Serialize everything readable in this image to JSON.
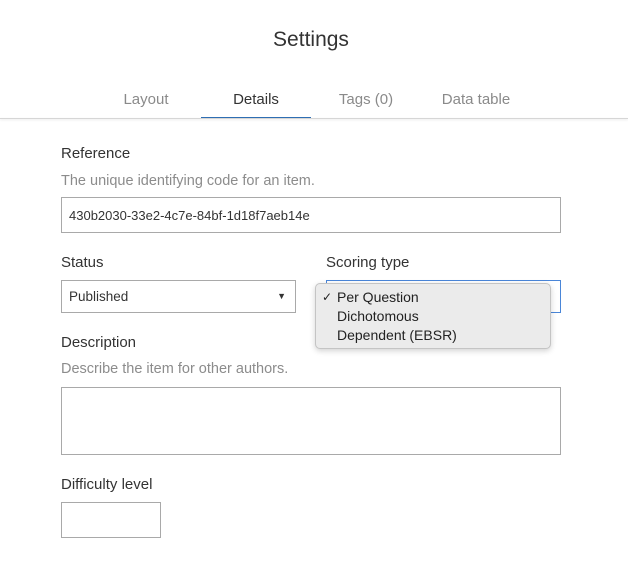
{
  "header": {
    "title": "Settings"
  },
  "tabs": [
    {
      "label": "Layout",
      "active": false
    },
    {
      "label": "Details",
      "active": true
    },
    {
      "label": "Tags (0)",
      "active": false
    },
    {
      "label": "Data table",
      "active": false
    }
  ],
  "reference": {
    "label": "Reference",
    "hint": "The unique identifying code for an item.",
    "value": "430b2030-33e2-4c7e-84bf-1d18f7aeb14e"
  },
  "status": {
    "label": "Status",
    "selected": "Published"
  },
  "scoring_type": {
    "label": "Scoring type",
    "options": [
      {
        "label": "Per Question",
        "checked": true
      },
      {
        "label": "Dichotomous",
        "checked": false
      },
      {
        "label": "Dependent (EBSR)",
        "checked": false
      }
    ],
    "check_glyph": "✓"
  },
  "description": {
    "label": "Description",
    "hint": "Describe the item for other authors.",
    "value": ""
  },
  "difficulty": {
    "label": "Difficulty level",
    "value": ""
  },
  "colors": {
    "accent": "#2f6fb5",
    "focus_border": "#4a86d8",
    "muted_text": "#8c8c8c"
  },
  "icons": {
    "select_arrow": "caret-down-icon",
    "option_check": "checkmark-icon"
  }
}
